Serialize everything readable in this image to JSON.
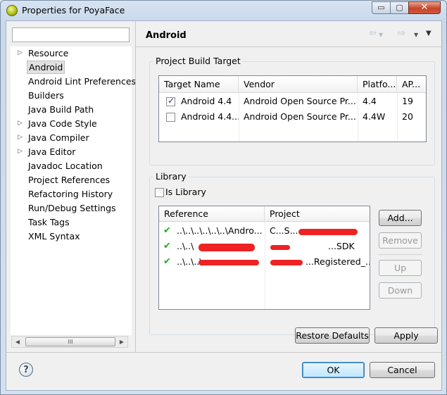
{
  "window": {
    "title": "Properties for PoyaFace",
    "minimize": "▭",
    "maximize": "▢",
    "close": "✕"
  },
  "nav": {
    "items": [
      {
        "label": "Resource",
        "expandable": true,
        "arrow": "▷"
      },
      {
        "label": "Android",
        "expandable": false,
        "selected": true,
        "arrow": ""
      },
      {
        "label": "Android Lint Preferences",
        "expandable": false,
        "arrow": ""
      },
      {
        "label": "Builders",
        "expandable": false,
        "arrow": ""
      },
      {
        "label": "Java Build Path",
        "expandable": false,
        "arrow": ""
      },
      {
        "label": "Java Code Style",
        "expandable": true,
        "arrow": "▷"
      },
      {
        "label": "Java Compiler",
        "expandable": true,
        "arrow": "▷"
      },
      {
        "label": "Java Editor",
        "expandable": true,
        "arrow": "▷"
      },
      {
        "label": "Javadoc Location",
        "expandable": false,
        "arrow": ""
      },
      {
        "label": "Project References",
        "expandable": false,
        "arrow": ""
      },
      {
        "label": "Refactoring History",
        "expandable": false,
        "arrow": ""
      },
      {
        "label": "Run/Debug Settings",
        "expandable": false,
        "arrow": ""
      },
      {
        "label": "Task Tags",
        "expandable": false,
        "arrow": ""
      },
      {
        "label": "XML Syntax",
        "expandable": false,
        "arrow": ""
      }
    ],
    "scroll_left": "◀",
    "scroll_right": "▶",
    "scroll_thumb": "III"
  },
  "page": {
    "title": "Android",
    "back": "⇦",
    "forward": "⇨",
    "menu": "▼"
  },
  "build_target": {
    "group_title": "Project Build Target",
    "columns": [
      "Target Name",
      "Vendor",
      "Platfo...",
      "AP..."
    ],
    "rows": [
      {
        "checked": true,
        "name": "Android 4.4",
        "vendor": "Android Open Source Pr...",
        "platform": "4.4",
        "api": "19"
      },
      {
        "checked": false,
        "name": "Android 4.4...",
        "vendor": "Android Open Source Pr...",
        "platform": "4.4W",
        "api": "20"
      }
    ]
  },
  "library": {
    "group_title": "Library",
    "is_library_label": "Is Library",
    "is_library_checked": false,
    "columns": [
      "Reference",
      "Project"
    ],
    "rows": [
      {
        "reference": "..\\..\\..\\..\\..\\..\\Andro...",
        "project": "C...S..."
      },
      {
        "reference": "..\\..\\",
        "project": "...SDK"
      },
      {
        "reference": "..\\..\\..\\",
        "project": "...Registered_..."
      }
    ],
    "buttons": {
      "add": "Add...",
      "remove": "Remove",
      "up": "Up",
      "down": "Down"
    }
  },
  "actions": {
    "restore": "Restore Defaults",
    "apply": "Apply",
    "ok": "OK",
    "cancel": "Cancel",
    "help": "?"
  },
  "colors": {
    "redaction": "#ee2222",
    "check": "#22aa22",
    "accent": "#3c7fb1"
  }
}
